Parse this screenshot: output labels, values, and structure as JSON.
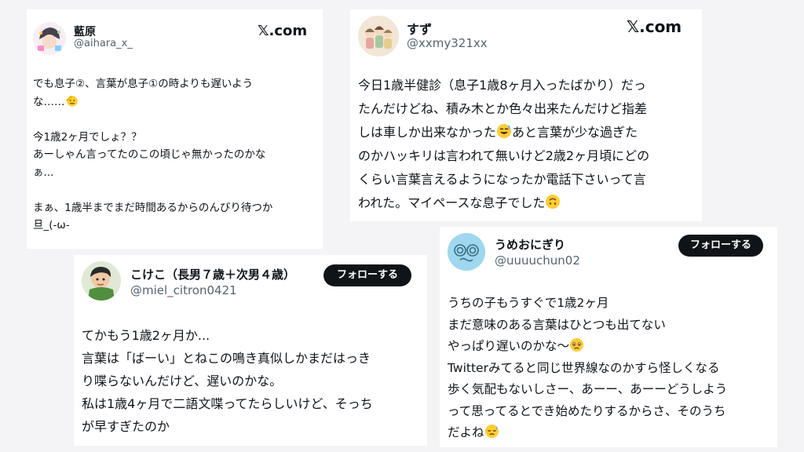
{
  "cards": [
    {
      "name": "藍原",
      "handle": "@aihara_x_",
      "site": "𝕏.com",
      "lines": [
        "でも息子②、言葉が息子①の時よりも遅いよう",
        "な……",
        "",
        "今1歳2ヶ月でしょ？？",
        "あーしゃん言ってたのこの頃じゃ無かったのかな",
        "ぁ...",
        "",
        "まぁ、1歳半までまだ時間あるからのんびり待つか",
        "旦_(-ω-"
      ],
      "emoji": "saluting-face-emoji"
    },
    {
      "name": "すず",
      "handle": "@xxmy321xx",
      "site": "𝕏.com",
      "lines": [
        "今日1歳半健診（息子1歳8ヶ月入ったばかり）だっ",
        "たんだけどね、積み木とか色々出来たんだけど指差",
        "しは車しか出来なかった",
        "のかハッキリは言われて無いけど2歳2ヶ月頃にどの",
        "くらい言葉言えるようになったか電話下さいって言",
        "われた。マイペースな息子でした"
      ],
      "line3_tail": "あと言葉が少な過ぎた",
      "emojis": [
        "sweat-smile-emoji",
        "upside-down-face-emoji"
      ]
    },
    {
      "name": "こけこ（長男７歳＋次男４歳）",
      "handle": "@miel_citron0421",
      "follow": "フォローする",
      "lines": [
        "てかもう1歳2ヶ月か...",
        "言葉は「ばーい」とねこの鳴き真似しかまだはっき",
        "り喋らないんだけど、遅いのかな。",
        "私は1歳4ヶ月で二語文喋ってたらしいけど、そっち",
        "が早すぎたのか"
      ]
    },
    {
      "name": "うめおにぎり",
      "handle": "@uuuuchun02",
      "follow": "フォローする",
      "lines": [
        "うちの子もうすぐで1歳2ヶ月",
        "まだ意味のある言葉はひとつも出てない",
        "やっぱり遅いのかな〜",
        "Twitterみてると同じ世界線なのかすら怪しくなる",
        "歩く気配もないしさー、あーー、あーーどうしよう",
        "って思ってるとでき始めたりするからさ、そのうち",
        "だよね"
      ],
      "emojis": [
        "holding-back-tears-emoji",
        "downcast-sweat-emoji"
      ]
    }
  ]
}
